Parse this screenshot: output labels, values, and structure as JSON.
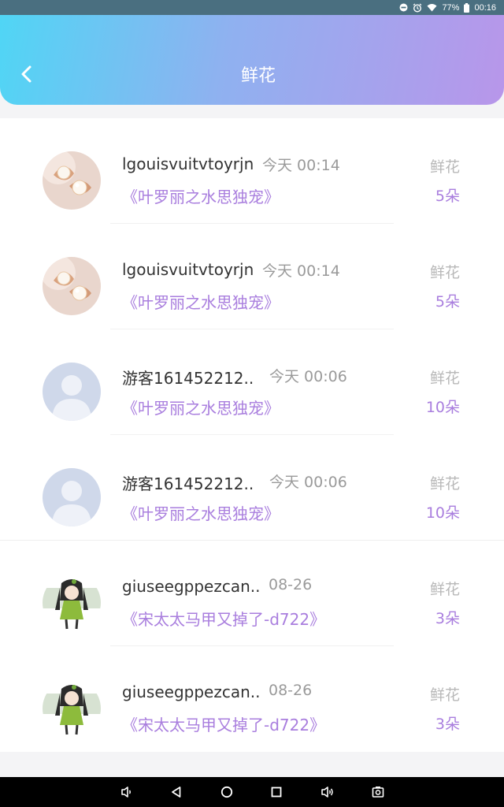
{
  "status_bar": {
    "battery_percent": "77%",
    "time": "00:16",
    "icons": [
      "minus-circle-icon",
      "alarm-icon",
      "wifi-icon",
      "battery-icon"
    ]
  },
  "header": {
    "title": "鲜花",
    "back_icon": "chevron-left-icon"
  },
  "records": [
    {
      "name": "lgouisvuitvtoyrjn",
      "time": "今天 00:14",
      "book": "《叶罗丽之水思独宠》",
      "gift_label": "鲜花",
      "count": "5朵",
      "avatar": "earrings"
    },
    {
      "name": "lgouisvuitvtoyrjn",
      "time": "今天 00:14",
      "book": "《叶罗丽之水思独宠》",
      "gift_label": "鲜花",
      "count": "5朵",
      "avatar": "earrings"
    },
    {
      "name": "游客161452212..",
      "time": "今天 00:06",
      "book": "《叶罗丽之水思独宠》",
      "gift_label": "鲜花",
      "count": "10朵",
      "avatar": "default-person"
    },
    {
      "name": "游客161452212..",
      "time": "今天 00:06",
      "book": "《叶罗丽之水思独宠》",
      "gift_label": "鲜花",
      "count": "10朵",
      "avatar": "default-person"
    },
    {
      "name": "giuseegppezcan..",
      "time": "08-26",
      "book": "《宋太太马甲又掉了-d722》",
      "gift_label": "鲜花",
      "count": "3朵",
      "avatar": "anime-girl"
    },
    {
      "name": "giuseegppezcan..",
      "time": "08-26",
      "book": "《宋太太马甲又掉了-d722》",
      "gift_label": "鲜花",
      "count": "3朵",
      "avatar": "anime-girl"
    }
  ],
  "nav_bar": {
    "icons": [
      "volume-down-icon",
      "back-triangle-icon",
      "home-circle-icon",
      "recents-square-icon",
      "volume-up-icon",
      "screenshot-icon"
    ]
  }
}
